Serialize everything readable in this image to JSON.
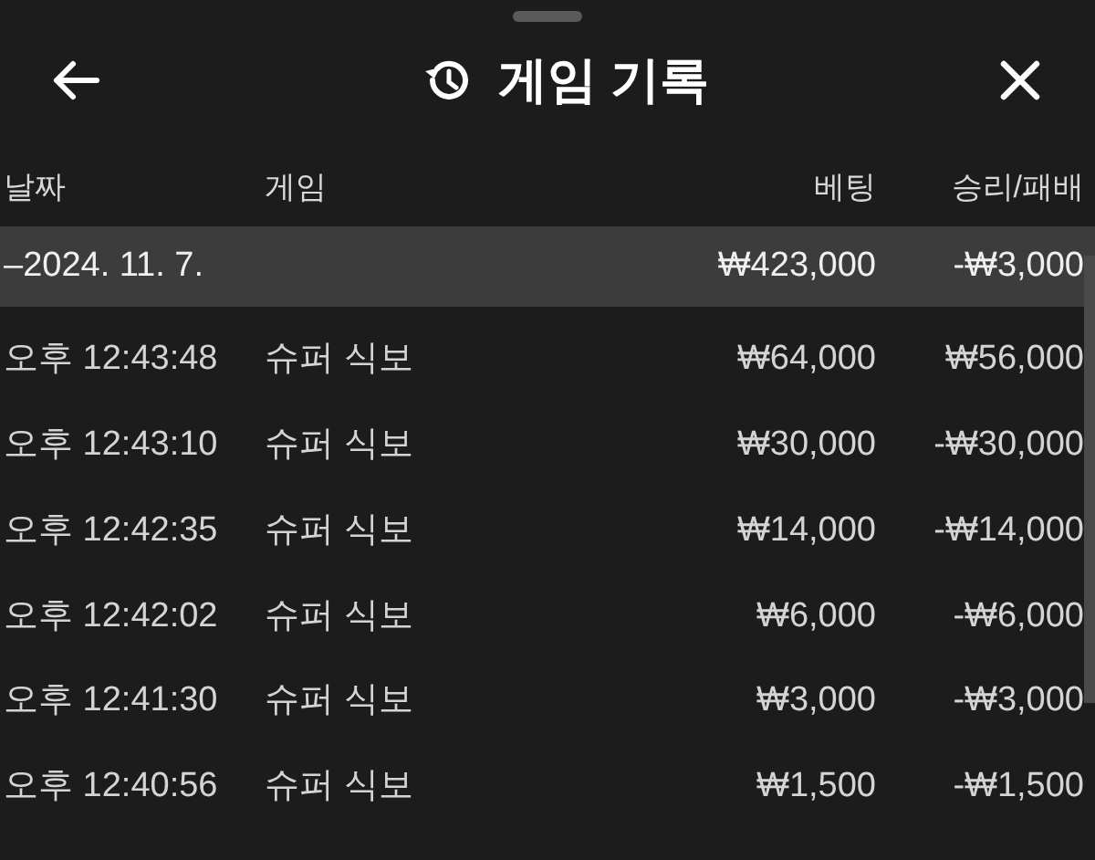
{
  "header": {
    "title": "게임 기록"
  },
  "table": {
    "columns": [
      "날짜",
      "게임",
      "베팅",
      "승리/패배"
    ],
    "group": {
      "label": "–2024. 11. 7.",
      "bet": "₩423,000",
      "result": "-₩3,000"
    },
    "rows": [
      {
        "time": "오후 12:43:48",
        "game": "슈퍼 식보",
        "bet": "₩64,000",
        "result": "₩56,000"
      },
      {
        "time": "오후 12:43:10",
        "game": "슈퍼 식보",
        "bet": "₩30,000",
        "result": "-₩30,000"
      },
      {
        "time": "오후 12:42:35",
        "game": "슈퍼 식보",
        "bet": "₩14,000",
        "result": "-₩14,000"
      },
      {
        "time": "오후 12:42:02",
        "game": "슈퍼 식보",
        "bet": "₩6,000",
        "result": "-₩6,000"
      },
      {
        "time": "오후 12:41:30",
        "game": "슈퍼 식보",
        "bet": "₩3,000",
        "result": "-₩3,000"
      },
      {
        "time": "오후 12:40:56",
        "game": "슈퍼 식보",
        "bet": "₩1,500",
        "result": "-₩1,500"
      }
    ]
  }
}
